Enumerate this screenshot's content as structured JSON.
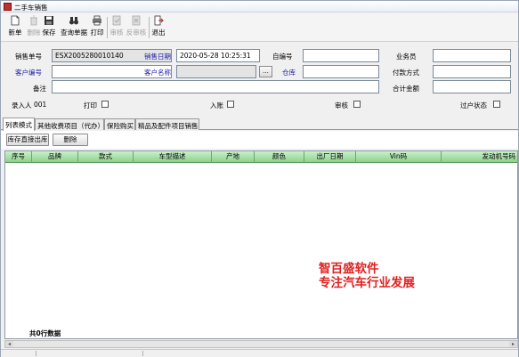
{
  "window": {
    "title": "二手车销售"
  },
  "toolbar": {
    "buttons": [
      {
        "label": "新单",
        "icon": "new-document-icon",
        "enabled": true
      },
      {
        "label": "删除",
        "icon": "delete-icon",
        "enabled": false
      },
      {
        "label": "保存",
        "icon": "save-icon",
        "enabled": true
      },
      {
        "label": "查询单据",
        "icon": "binoculars-icon",
        "enabled": true
      },
      {
        "label": "打印",
        "icon": "printer-icon",
        "enabled": true
      },
      {
        "label": "审核",
        "icon": "approve-icon",
        "enabled": false
      },
      {
        "label": "反审核",
        "icon": "unapprove-icon",
        "enabled": false
      },
      {
        "label": "退出",
        "icon": "exit-icon",
        "enabled": true
      }
    ]
  },
  "form": {
    "sales_no_label": "销售单号",
    "sales_no_value": "ESX2005280010140",
    "sales_date_label": "销售日期",
    "sales_date_value": "2020-05-28 10:25:31",
    "self_no_label": "自编号",
    "self_no_value": "",
    "salesman_label": "业务员",
    "salesman_value": "",
    "customer_no_label": "客户编号",
    "customer_no_value": "",
    "customer_name_label": "客户名称",
    "customer_name_value": "",
    "browse_label": "...",
    "warehouse_label": "仓库",
    "warehouse_value": "",
    "payment_label": "付款方式",
    "payment_value": "",
    "remark_label": "备注",
    "remark_value": "",
    "total_label": "合计金额",
    "total_value": "",
    "entered_by_label": "录入人",
    "entered_by_value": "001",
    "print_label": "打印",
    "posted_label": "入账",
    "audit_label": "审核",
    "transfer_label": "过户状态"
  },
  "tabs": [
    {
      "label": "列表模式",
      "active": true
    },
    {
      "label": "其他收费项目（代办）",
      "active": false
    },
    {
      "label": "保险购买",
      "active": false
    },
    {
      "label": "精品及配件项目销售",
      "active": false
    }
  ],
  "actions": {
    "stock_out_label": "库存直接出库",
    "delete_label": "删除"
  },
  "grid": {
    "columns": [
      "序号",
      "品牌",
      "款式",
      "车型描述",
      "产地",
      "颜色",
      "出厂日期",
      "Vin码",
      "发动机号码"
    ],
    "row_count_text": "共0行数据"
  },
  "watermark": {
    "line1": "智百盛软件",
    "line2": "专注汽车行业发展",
    "color": "#e02020"
  },
  "colors": {
    "grid_header": "#8fd08f",
    "link_label": "#1a1aa8"
  }
}
